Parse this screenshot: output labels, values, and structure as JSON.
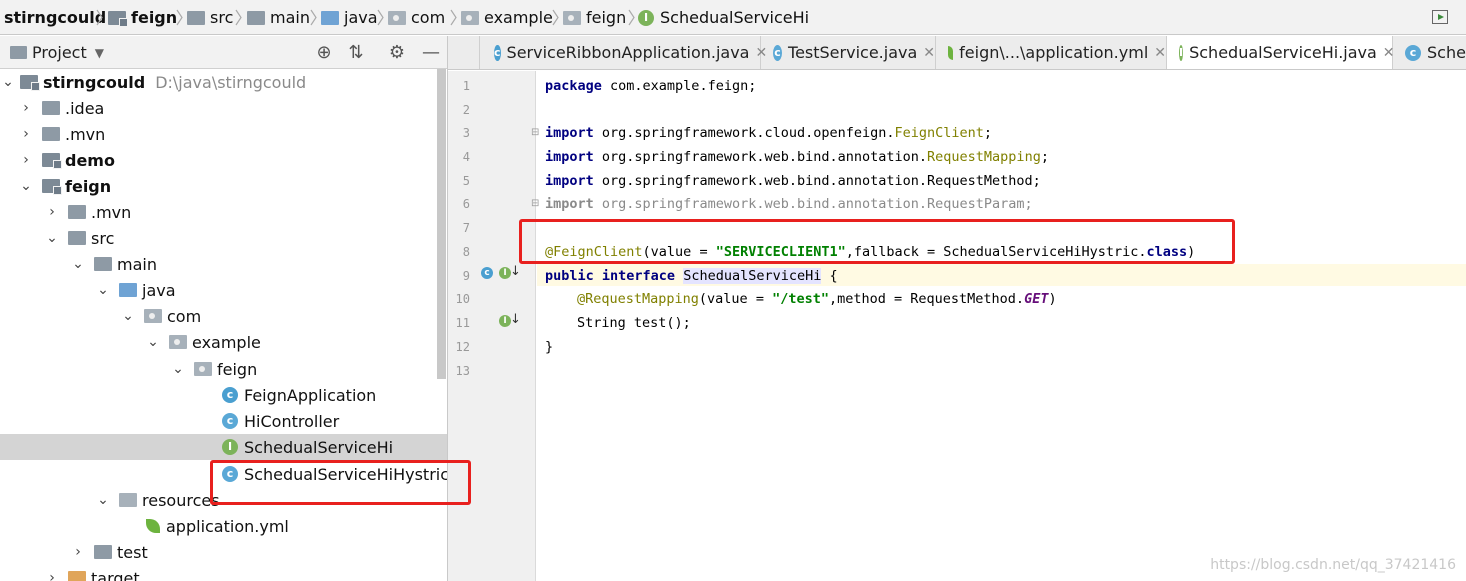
{
  "breadcrumb": [
    "stirngcould",
    "feign",
    "src",
    "main",
    "java",
    "com",
    "example",
    "feign",
    "SchedualServiceHi"
  ],
  "sidebar": {
    "title": "Project",
    "tree": [
      {
        "label": "stirngcould",
        "path": "D:\\java\\stirngcould",
        "bold": true
      },
      {
        "label": ".idea"
      },
      {
        "label": ".mvn"
      },
      {
        "label": "demo",
        "bold": true
      },
      {
        "label": "feign",
        "bold": true
      },
      {
        "label": ".mvn"
      },
      {
        "label": "src"
      },
      {
        "label": "main"
      },
      {
        "label": "java"
      },
      {
        "label": "com"
      },
      {
        "label": "example"
      },
      {
        "label": "feign"
      },
      {
        "label": "FeignApplication"
      },
      {
        "label": "HiController"
      },
      {
        "label": "SchedualServiceHi"
      },
      {
        "label": "SchedualServiceHiHystric"
      },
      {
        "label": "resources"
      },
      {
        "label": "application.yml"
      },
      {
        "label": "test"
      },
      {
        "label": "target"
      }
    ]
  },
  "tabs": [
    {
      "label": "ServiceRibbonApplication.java"
    },
    {
      "label": "TestService.java"
    },
    {
      "label": "feign\\...\\application.yml"
    },
    {
      "label": "SchedualServiceHi.java"
    },
    {
      "label": "Sched"
    }
  ],
  "editor": {
    "line_numbers": [
      "1",
      "2",
      "3",
      "4",
      "5",
      "6",
      "7",
      "8",
      "9",
      "10",
      "11",
      "12",
      "13"
    ],
    "lines": {
      "l1_kw": "package",
      "l1_rest": " com.example.feign;",
      "l3_kw": "import",
      "l3_pkg": " org.springframework.cloud.openfeign.",
      "l3_cls": "FeignClient",
      "l3_end": ";",
      "l4_kw": "import",
      "l4_pkg": " org.springframework.web.bind.annotation.",
      "l4_cls": "RequestMapping",
      "l4_end": ";",
      "l5_kw": "import",
      "l5_rest": " org.springframework.web.bind.annotation.RequestMethod;",
      "l6_kw": "import",
      "l6_rest": " org.springframework.web.bind.annotation.RequestParam;",
      "l8_ann": "@FeignClient",
      "l8_a": "(value = ",
      "l8_str": "\"SERVICECLIENT1\"",
      "l8_b": ",fallback = SchedualServiceHiHystric.",
      "l8_kw": "class",
      "l8_c": ")",
      "l9_kw1": "public",
      "l9_kw2": " interface",
      "l9_sp": " ",
      "l9_name": "SchedualServiceHi",
      "l9_end": " {",
      "l10_ann": "@RequestMapping",
      "l10_a": "(value = ",
      "l10_str": "\"/test\"",
      "l10_b": ",method = RequestMethod.",
      "l10_get": "GET",
      "l10_c": ")",
      "l11": "String test();",
      "l12": "}"
    }
  },
  "watermark": "https://blog.csdn.net/qq_37421416"
}
